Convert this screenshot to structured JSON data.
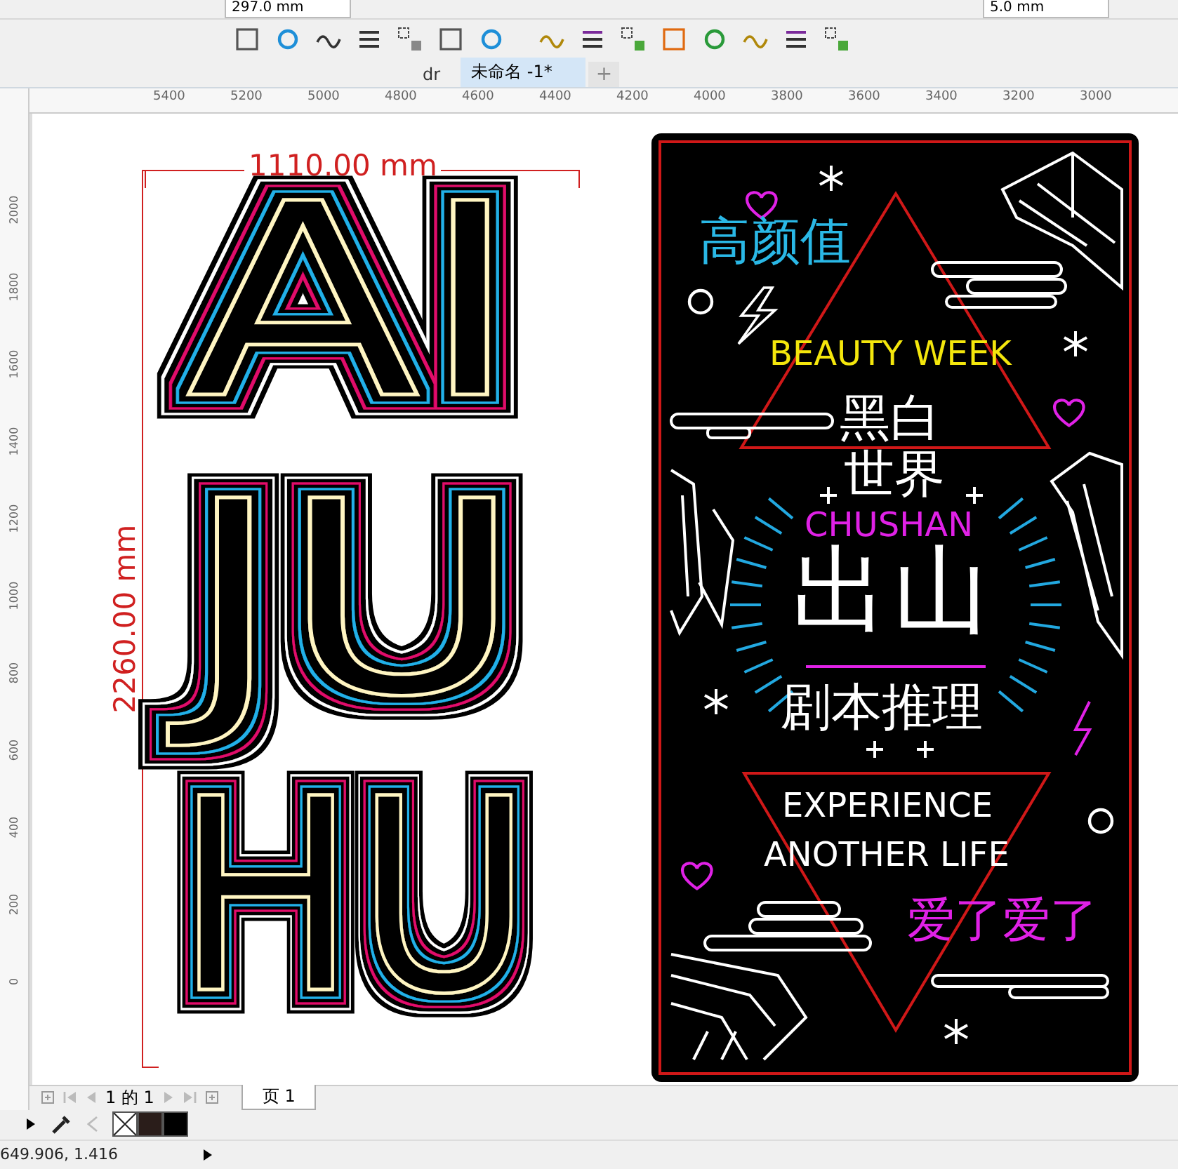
{
  "property_bar": {
    "fields": [
      "297.0 mm",
      "5.0 mm"
    ]
  },
  "document_tabs": [
    {
      "label": "dr",
      "selected": false
    },
    {
      "label": "未命名 -1*",
      "selected": true
    }
  ],
  "new_tab_button": "+",
  "horizontal_ruler": [
    "5400",
    "5200",
    "5000",
    "4800",
    "4600",
    "4400",
    "4200",
    "4000",
    "3800",
    "3600",
    "3400",
    "3200",
    "3000"
  ],
  "vertical_ruler": [
    "2000",
    "1800",
    "1600",
    "1400",
    "1200",
    "1000",
    "800",
    "600",
    "400",
    "200",
    "0"
  ],
  "artwork_left": {
    "width_dimension": "1110.00 mm",
    "height_dimension": "2260.00 mm",
    "letters": [
      "AI",
      "JU",
      "HU"
    ]
  },
  "poster": {
    "texts": [
      {
        "text": "高颜值",
        "color": "#2ab8e6"
      },
      {
        "text": "BEAUTY WEEK",
        "color": "#f4e60c"
      },
      {
        "text": "黑白",
        "color": "#ffffff"
      },
      {
        "text": "世界",
        "color": "#ffffff"
      },
      {
        "text": "CHUSHAN",
        "color": "#e021e6"
      },
      {
        "text": "出山",
        "color": "#ffffff"
      },
      {
        "text": "剧本推理",
        "color": "#ffffff"
      },
      {
        "text": "EXPERIENCE",
        "color": "#ffffff"
      },
      {
        "text": "ANOTHER LIFE",
        "color": "#ffffff"
      },
      {
        "text": "爱了爱了",
        "color": "#e021e6"
      }
    ]
  },
  "page_nav": {
    "page_info": "1 的 1",
    "page_tab": "页 1"
  },
  "palette": [
    {
      "kind": "none"
    },
    {
      "kind": "color",
      "color": "#2a1d1a"
    },
    {
      "kind": "color",
      "color": "#000000"
    }
  ],
  "status_bar": {
    "coordinates": "649.906, 1.416"
  }
}
